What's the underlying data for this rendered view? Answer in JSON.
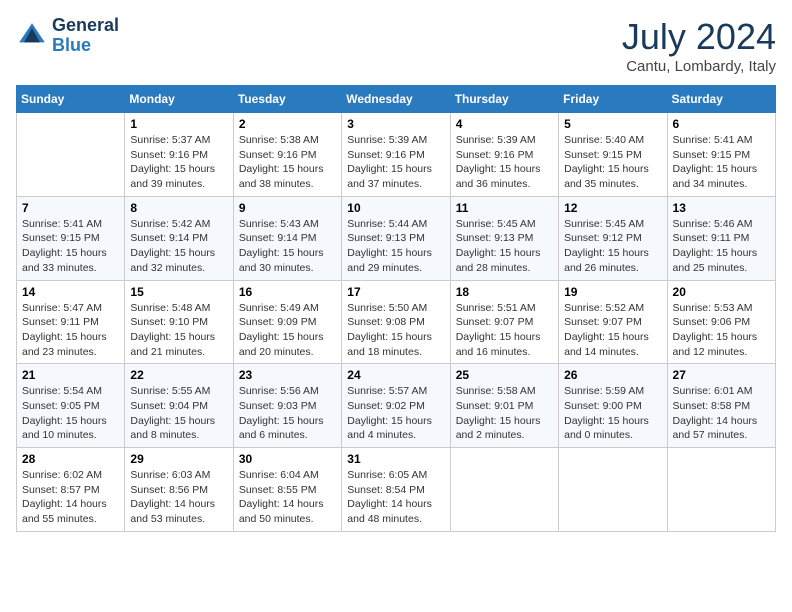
{
  "header": {
    "logo_line1": "General",
    "logo_line2": "Blue",
    "month": "July 2024",
    "location": "Cantu, Lombardy, Italy"
  },
  "weekdays": [
    "Sunday",
    "Monday",
    "Tuesday",
    "Wednesday",
    "Thursday",
    "Friday",
    "Saturday"
  ],
  "weeks": [
    [
      {
        "day": "",
        "info": ""
      },
      {
        "day": "1",
        "info": "Sunrise: 5:37 AM\nSunset: 9:16 PM\nDaylight: 15 hours\nand 39 minutes."
      },
      {
        "day": "2",
        "info": "Sunrise: 5:38 AM\nSunset: 9:16 PM\nDaylight: 15 hours\nand 38 minutes."
      },
      {
        "day": "3",
        "info": "Sunrise: 5:39 AM\nSunset: 9:16 PM\nDaylight: 15 hours\nand 37 minutes."
      },
      {
        "day": "4",
        "info": "Sunrise: 5:39 AM\nSunset: 9:16 PM\nDaylight: 15 hours\nand 36 minutes."
      },
      {
        "day": "5",
        "info": "Sunrise: 5:40 AM\nSunset: 9:15 PM\nDaylight: 15 hours\nand 35 minutes."
      },
      {
        "day": "6",
        "info": "Sunrise: 5:41 AM\nSunset: 9:15 PM\nDaylight: 15 hours\nand 34 minutes."
      }
    ],
    [
      {
        "day": "7",
        "info": "Sunrise: 5:41 AM\nSunset: 9:15 PM\nDaylight: 15 hours\nand 33 minutes."
      },
      {
        "day": "8",
        "info": "Sunrise: 5:42 AM\nSunset: 9:14 PM\nDaylight: 15 hours\nand 32 minutes."
      },
      {
        "day": "9",
        "info": "Sunrise: 5:43 AM\nSunset: 9:14 PM\nDaylight: 15 hours\nand 30 minutes."
      },
      {
        "day": "10",
        "info": "Sunrise: 5:44 AM\nSunset: 9:13 PM\nDaylight: 15 hours\nand 29 minutes."
      },
      {
        "day": "11",
        "info": "Sunrise: 5:45 AM\nSunset: 9:13 PM\nDaylight: 15 hours\nand 28 minutes."
      },
      {
        "day": "12",
        "info": "Sunrise: 5:45 AM\nSunset: 9:12 PM\nDaylight: 15 hours\nand 26 minutes."
      },
      {
        "day": "13",
        "info": "Sunrise: 5:46 AM\nSunset: 9:11 PM\nDaylight: 15 hours\nand 25 minutes."
      }
    ],
    [
      {
        "day": "14",
        "info": "Sunrise: 5:47 AM\nSunset: 9:11 PM\nDaylight: 15 hours\nand 23 minutes."
      },
      {
        "day": "15",
        "info": "Sunrise: 5:48 AM\nSunset: 9:10 PM\nDaylight: 15 hours\nand 21 minutes."
      },
      {
        "day": "16",
        "info": "Sunrise: 5:49 AM\nSunset: 9:09 PM\nDaylight: 15 hours\nand 20 minutes."
      },
      {
        "day": "17",
        "info": "Sunrise: 5:50 AM\nSunset: 9:08 PM\nDaylight: 15 hours\nand 18 minutes."
      },
      {
        "day": "18",
        "info": "Sunrise: 5:51 AM\nSunset: 9:07 PM\nDaylight: 15 hours\nand 16 minutes."
      },
      {
        "day": "19",
        "info": "Sunrise: 5:52 AM\nSunset: 9:07 PM\nDaylight: 15 hours\nand 14 minutes."
      },
      {
        "day": "20",
        "info": "Sunrise: 5:53 AM\nSunset: 9:06 PM\nDaylight: 15 hours\nand 12 minutes."
      }
    ],
    [
      {
        "day": "21",
        "info": "Sunrise: 5:54 AM\nSunset: 9:05 PM\nDaylight: 15 hours\nand 10 minutes."
      },
      {
        "day": "22",
        "info": "Sunrise: 5:55 AM\nSunset: 9:04 PM\nDaylight: 15 hours\nand 8 minutes."
      },
      {
        "day": "23",
        "info": "Sunrise: 5:56 AM\nSunset: 9:03 PM\nDaylight: 15 hours\nand 6 minutes."
      },
      {
        "day": "24",
        "info": "Sunrise: 5:57 AM\nSunset: 9:02 PM\nDaylight: 15 hours\nand 4 minutes."
      },
      {
        "day": "25",
        "info": "Sunrise: 5:58 AM\nSunset: 9:01 PM\nDaylight: 15 hours\nand 2 minutes."
      },
      {
        "day": "26",
        "info": "Sunrise: 5:59 AM\nSunset: 9:00 PM\nDaylight: 15 hours\nand 0 minutes."
      },
      {
        "day": "27",
        "info": "Sunrise: 6:01 AM\nSunset: 8:58 PM\nDaylight: 14 hours\nand 57 minutes."
      }
    ],
    [
      {
        "day": "28",
        "info": "Sunrise: 6:02 AM\nSunset: 8:57 PM\nDaylight: 14 hours\nand 55 minutes."
      },
      {
        "day": "29",
        "info": "Sunrise: 6:03 AM\nSunset: 8:56 PM\nDaylight: 14 hours\nand 53 minutes."
      },
      {
        "day": "30",
        "info": "Sunrise: 6:04 AM\nSunset: 8:55 PM\nDaylight: 14 hours\nand 50 minutes."
      },
      {
        "day": "31",
        "info": "Sunrise: 6:05 AM\nSunset: 8:54 PM\nDaylight: 14 hours\nand 48 minutes."
      },
      {
        "day": "",
        "info": ""
      },
      {
        "day": "",
        "info": ""
      },
      {
        "day": "",
        "info": ""
      }
    ]
  ]
}
